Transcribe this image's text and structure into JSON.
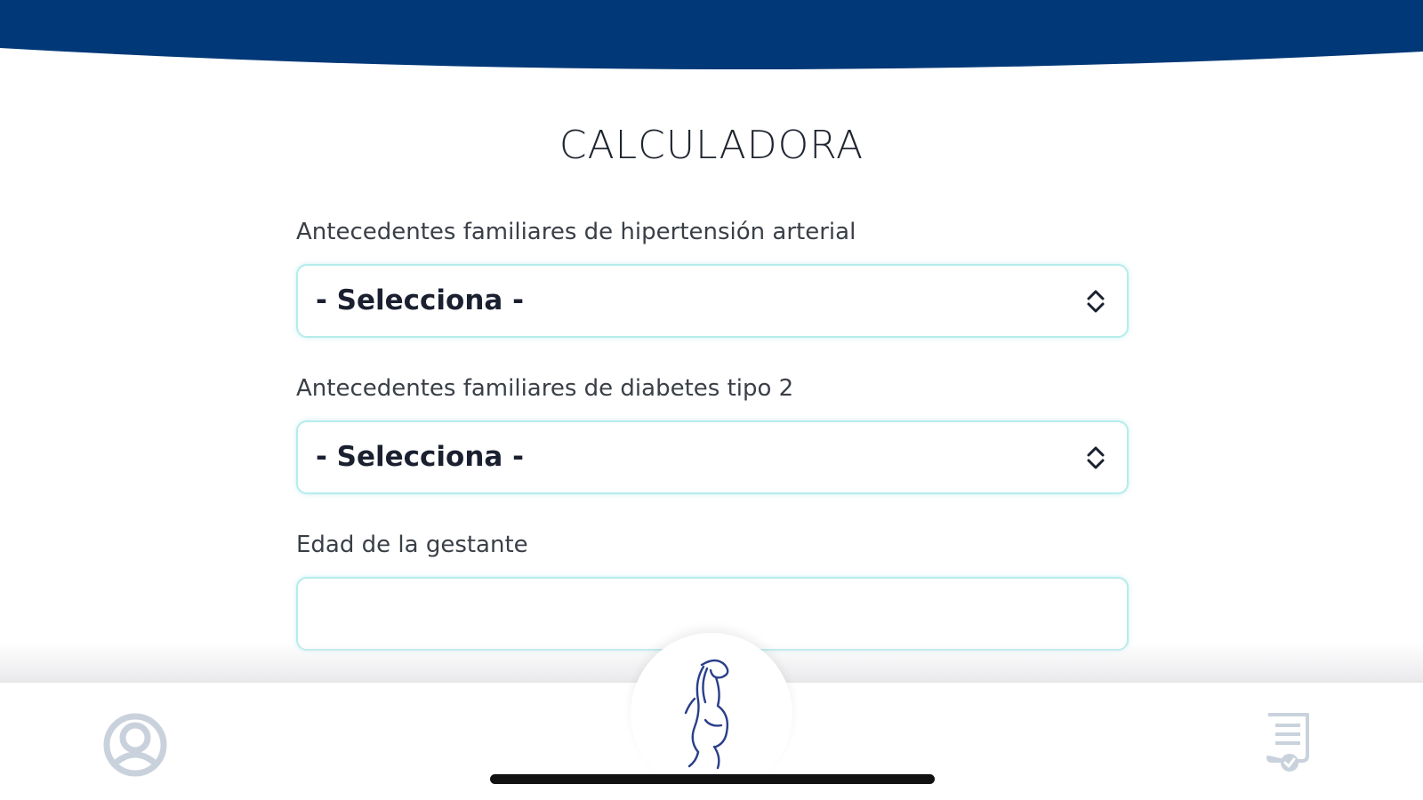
{
  "page": {
    "title": "CALCULADORA"
  },
  "colors": {
    "header": "#003878",
    "field_border": "#b6ecec",
    "icon_grey": "#c9d2dc",
    "logo_blue": "#2a3f8a"
  },
  "form": {
    "fields": [
      {
        "label": "Antecedentes familiares de hipertensión arterial",
        "type": "select",
        "value": "- Selecciona -"
      },
      {
        "label": "Antecedentes familiares de diabetes tipo 2",
        "type": "select",
        "value": "- Selecciona -"
      },
      {
        "label": "Edad de la gestante",
        "type": "text",
        "value": ""
      }
    ]
  },
  "bottom_nav": {
    "items": [
      {
        "icon": "user-profile-icon"
      },
      {
        "icon": "pregnant-woman-logo-icon"
      },
      {
        "icon": "report-check-icon"
      }
    ]
  }
}
